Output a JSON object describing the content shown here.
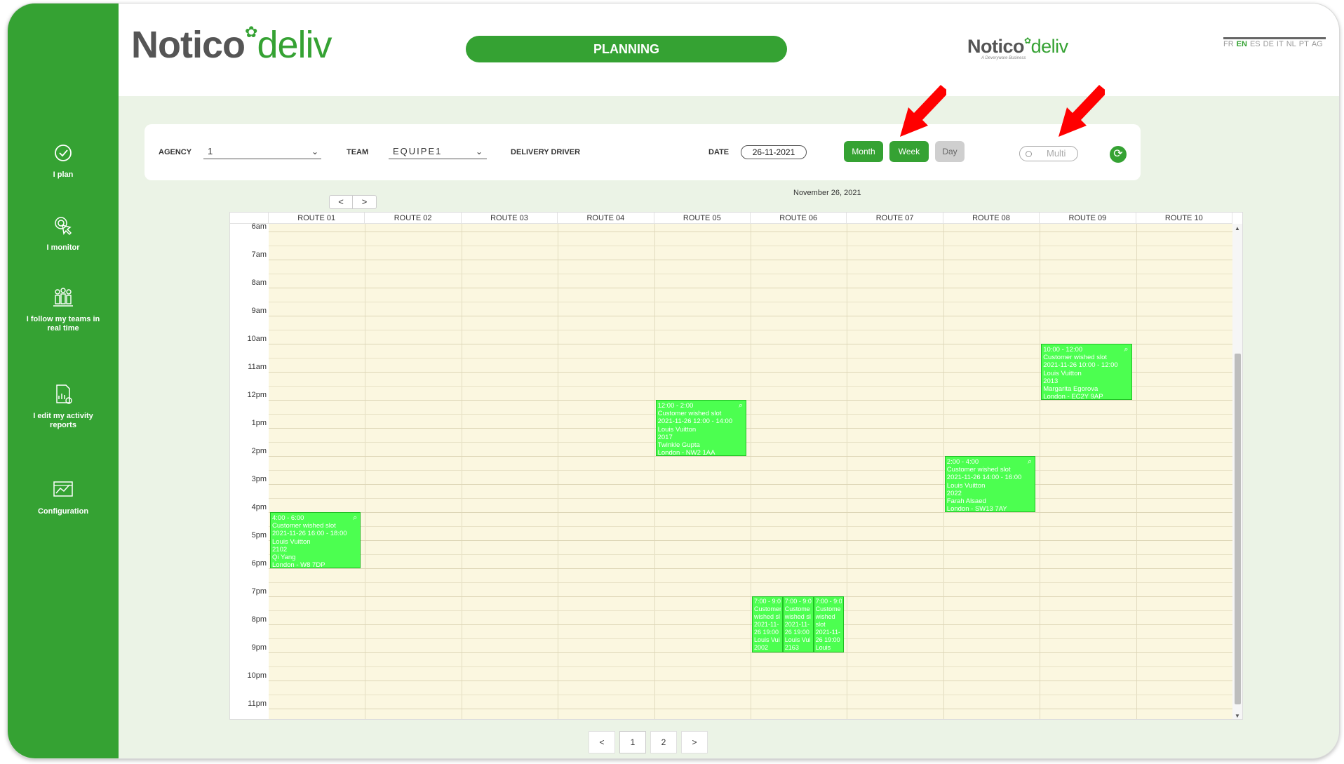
{
  "sidebar": {
    "items": [
      {
        "label": "I plan",
        "icon": "check-circle-icon"
      },
      {
        "label": "I monitor",
        "icon": "touch-icon"
      },
      {
        "label": "I follow my teams in real time",
        "icon": "team-icon"
      },
      {
        "label": "I edit my activity reports",
        "icon": "report-icon"
      },
      {
        "label": "Configuration",
        "icon": "settings-chart-icon"
      }
    ]
  },
  "header": {
    "logo_part1": "Notico",
    "logo_part2": "deliv",
    "title": "PLANNING",
    "small_logo_part1": "Notico",
    "small_logo_part2": "deliv",
    "small_logo_sub": "A Deveryware Business",
    "languages": [
      "FR",
      "EN",
      "ES",
      "DE",
      "IT",
      "NL",
      "PT",
      "AG"
    ],
    "active_language": "EN"
  },
  "toolbar": {
    "agency_label": "AGENCY",
    "agency_value": "1",
    "team_label": "TEAM",
    "team_value": "EQUIPE1",
    "driver_label": "DELIVERY DRIVER",
    "date_label": "DATE",
    "date_value": "26-11-2021",
    "month_label": "Month",
    "week_label": "Week",
    "day_label": "Day",
    "multi_label": "Multi"
  },
  "calendar": {
    "title": "November 26, 2021",
    "prev": "<",
    "next": ">",
    "routes": [
      "ROUTE 01",
      "ROUTE 02",
      "ROUTE 03",
      "ROUTE 04",
      "ROUTE 05",
      "ROUTE 06",
      "ROUTE 07",
      "ROUTE 08",
      "ROUTE 09",
      "ROUTE 10"
    ],
    "hours": [
      "6am",
      "7am",
      "8am",
      "9am",
      "10am",
      "11am",
      "12pm",
      "1pm",
      "2pm",
      "3pm",
      "4pm",
      "5pm",
      "6pm",
      "7pm",
      "8pm",
      "9pm",
      "10pm",
      "11pm"
    ],
    "events": [
      {
        "lines": [
          "4:00 - 6:00",
          "Customer wished slot",
          "2021-11-26 16:00 - 18:00",
          "Louis Vuitton",
          "2102",
          "Qi Yang",
          "London - W8 7DP"
        ]
      },
      {
        "lines": [
          "12:00 - 2:00",
          "Customer wished slot",
          "2021-11-26 12:00 - 14:00",
          "Louis Vuitton",
          "2017",
          "Twinkle Gupta",
          "London - NW2 1AA"
        ]
      },
      {
        "lines": [
          "2:00 - 4:00",
          "Customer wished slot",
          "2021-11-26 14:00 - 16:00",
          "Louis Vuitton",
          "2022",
          "Farah Alsaed",
          "London - SW13 7AY"
        ]
      },
      {
        "lines": [
          "10:00 - 12:00",
          "Customer wished slot",
          "2021-11-26 10:00 - 12:00",
          "Louis Vuitton",
          "2013",
          "Margarita Egorova",
          "London - EC2Y 9AP"
        ]
      }
    ],
    "mini_events": [
      {
        "lines": [
          "7:00 - 9:0",
          "Customer",
          "wished sl",
          "2021-11-",
          "26 19:00",
          "Louis Vui",
          "2002"
        ]
      },
      {
        "lines": [
          "7:00 - 9:0",
          "Custome",
          "wished sl",
          "2021-11-",
          "26 19:00",
          "Louis Vui",
          "2163"
        ]
      },
      {
        "lines": [
          "7:00 - 9:0",
          "Custome",
          "wished",
          "slot",
          "2021-11-",
          "26 19:00",
          "Louis"
        ]
      }
    ]
  },
  "pagination": {
    "prev": "<",
    "pages": [
      "1",
      "2"
    ],
    "next": ">",
    "active": "1"
  },
  "colors": {
    "brand": "#35a233",
    "event": "#4cff50",
    "grid_bg": "#fbf7e0",
    "arrow": "#ff0000"
  }
}
